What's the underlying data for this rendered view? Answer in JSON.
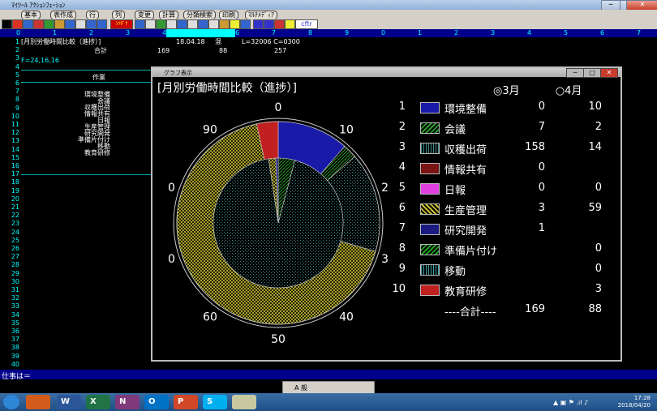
{
  "window": {
    "title": "ﾏｲﾂｰﾙ ｱｸｼｮﾝﾌｪｰｼｮﾝ",
    "min": "─",
    "max": "□",
    "close": "✕"
  },
  "menu": [
    "基本",
    "表作成",
    "行",
    "列",
    "変更",
    "計算",
    "分類検索",
    "印刷",
    "ﾏﾙﾁﾒﾃﾞｨｱ"
  ],
  "toolbar": {
    "sitsu": "ｼﾂﾀﾞｹ",
    "cftr": "cftr"
  },
  "ruler": [
    "0",
    "1",
    "2",
    "3",
    "4",
    "5",
    "6",
    "7",
    "8",
    "9",
    "0",
    "1",
    "2",
    "3",
    "4",
    "5",
    "6",
    "7",
    "8"
  ],
  "rows": [
    "1",
    "2",
    "3",
    "4",
    "5",
    "6",
    "7",
    "8",
    "9",
    "10",
    "11",
    "12",
    "13",
    "14",
    "15",
    "16",
    "17",
    "18",
    "19",
    "20",
    "21",
    "22",
    "23",
    "24",
    "25",
    "26",
    "27",
    "28",
    "29",
    "30",
    "31",
    "32",
    "33",
    "34",
    "35",
    "36",
    "37",
    "38",
    "39",
    "40"
  ],
  "sheet": {
    "r1_title": "[月別労働時間比較（進捗）]",
    "r1_date": "18.04.18",
    "r1_mode": "混",
    "r1_pos": "L=32006 C=0300",
    "r2_total": "合計",
    "r2_v1": "169",
    "r2_v2": "88",
    "r2_v3": "257",
    "r3_formula": "F=24,16,16",
    "task_header": "作業",
    "tasks": [
      "環境整備",
      "会議",
      "収穫出荷",
      "情報共有",
      "日報",
      "生産管理",
      "研究開発",
      "準備片付け",
      "移動",
      "教育研修"
    ]
  },
  "graph_window": {
    "title": "グラフ表示",
    "min": "─",
    "max": "□",
    "close": "✕"
  },
  "chart_data": {
    "type": "pie",
    "title": "[月別労働時間比較（進捗）]",
    "series": [
      {
        "name": "3月",
        "values": [
          0,
          7,
          158,
          0,
          0,
          3,
          1,
          null,
          null,
          null
        ]
      },
      {
        "name": "4月",
        "values": [
          10,
          2,
          14,
          null,
          0,
          59,
          null,
          0,
          0,
          3
        ]
      }
    ],
    "categories": [
      "環境整備",
      "会議",
      "収穫出荷",
      "情報共有",
      "日報",
      "生産管理",
      "研究開発",
      "準備片付け",
      "移動",
      "教育研修"
    ],
    "numbers": [
      "1",
      "2",
      "3",
      "4",
      "5",
      "6",
      "7",
      "8",
      "9",
      "10"
    ],
    "totals": {
      "label": "----合計----",
      "march": "169",
      "april": "88"
    },
    "month_selected": "3月",
    "month_other": "4月",
    "dial_labels": [
      "0",
      "10",
      "20",
      "30",
      "40",
      "50",
      "60",
      "70",
      "80",
      "90"
    ],
    "colors": [
      "#1a1aa8",
      "#2e9a2e",
      "#3f8c8c",
      "#7a1414",
      "#e040e0",
      "#c8c030",
      "#1a1a80",
      "#20a020",
      "#40a0a0",
      "#c02020"
    ]
  },
  "statusbar": {
    "text": "仕事は＝"
  },
  "ime": {
    "text": "A 般"
  },
  "taskbar": {
    "apps": [
      "W",
      "X",
      "N",
      "O",
      "P",
      "S"
    ],
    "time": "17:28",
    "date": "2018/04/20"
  }
}
